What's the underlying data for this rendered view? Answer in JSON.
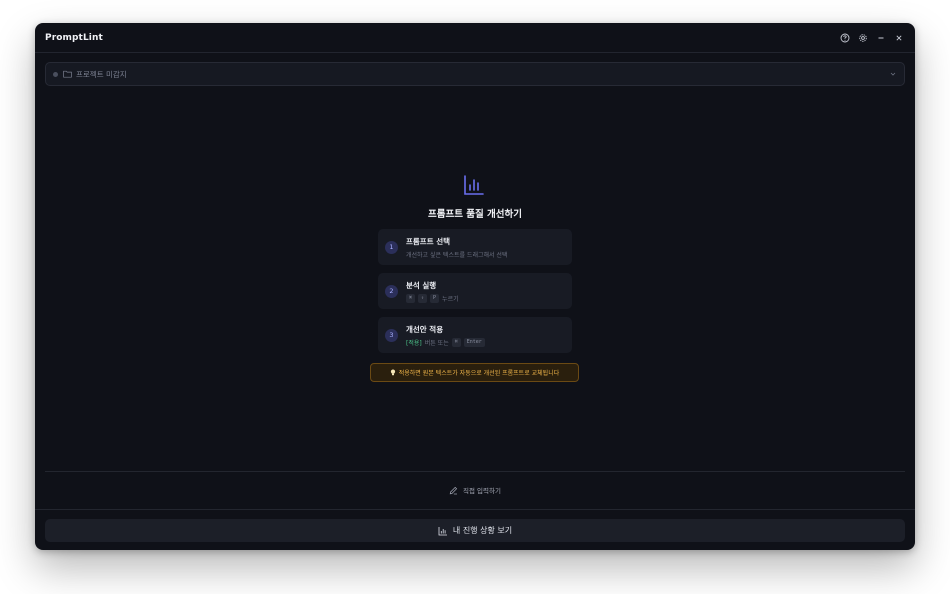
{
  "app": {
    "title": "PromptLint",
    "window_controls": [
      "help-icon",
      "gear-icon",
      "minimize-icon",
      "close-icon"
    ]
  },
  "project": {
    "label": "프로젝트 미감지",
    "status": "inactive"
  },
  "hero": {
    "icon": "bar-chart-icon",
    "title": "프롬프트 품질 개선하기"
  },
  "steps": [
    {
      "number": "1",
      "title": "프롬프트 선택",
      "desc": "개선하고 싶은 텍스트를 드래그해서 선택"
    },
    {
      "number": "2",
      "title": "분석 실행",
      "keys": [
        "⌘",
        "⇧",
        "P"
      ],
      "desc_suffix": "누르기"
    },
    {
      "number": "3",
      "title": "개선안 적용",
      "highlight": "[적용]",
      "desc_mid": "버튼 또는",
      "keys": [
        "⌘",
        "Enter"
      ]
    }
  ],
  "tip": {
    "icon": "lightbulb-icon",
    "text": "적용하면 원본 텍스트가 자동으로 개선된 프롬프트로 교체됩니다"
  },
  "manual_input": {
    "icon": "pencil-icon",
    "label": "직접 입력하기"
  },
  "footer": {
    "icon": "bar-chart-icon",
    "label": "내 진행 상황 보기"
  },
  "colors": {
    "window_bg": "#0f1118",
    "card_bg": "#181b24",
    "accent": "#6a6ff0",
    "tip_text": "#f0b54a",
    "green": "#4cc38a"
  }
}
